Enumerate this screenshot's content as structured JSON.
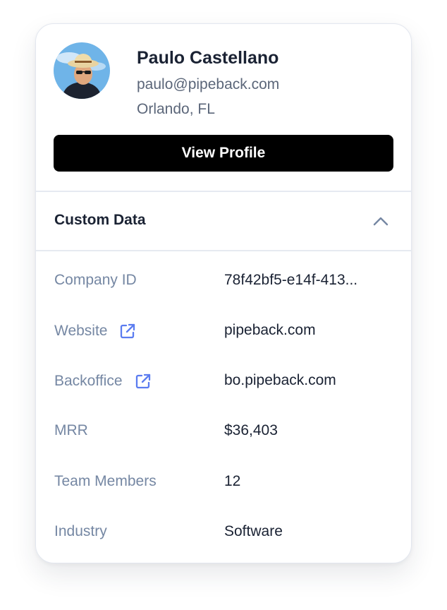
{
  "profile": {
    "name": "Paulo Castellano",
    "email": "paulo@pipeback.com",
    "location": "Orlando, FL",
    "view_button": "View Profile",
    "avatar_icon": "user-avatar-photo"
  },
  "custom_data": {
    "title": "Custom Data",
    "expanded": true,
    "toggle_icon": "chevron-up-icon",
    "rows": [
      {
        "label": "Company ID",
        "value": "78f42bf5-e14f-413...",
        "link": false
      },
      {
        "label": "Website",
        "value": "pipeback.com",
        "link": true,
        "icon": "external-link-icon"
      },
      {
        "label": "Backoffice",
        "value": "bo.pipeback.com",
        "link": true,
        "icon": "external-link-icon"
      },
      {
        "label": "MRR",
        "value": "$36,403",
        "link": false
      },
      {
        "label": "Team Members",
        "value": "12",
        "link": false
      },
      {
        "label": "Industry",
        "value": "Software",
        "link": false
      }
    ]
  },
  "colors": {
    "button_bg": "#000000",
    "link_icon": "#5b7cf0",
    "label": "#7587a3",
    "value": "#1a2233"
  }
}
